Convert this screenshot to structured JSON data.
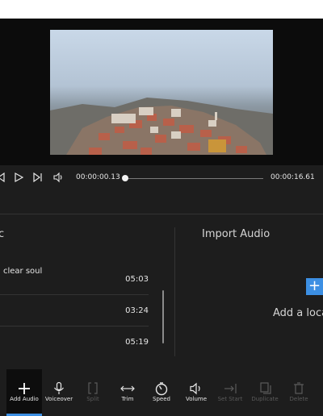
{
  "player": {
    "current_time": "00:00:00.13",
    "total_time": "00:00:16.61",
    "progress": 0.008
  },
  "music_panel": {
    "title": "c",
    "tracks": [
      {
        "name": "clear soul",
        "duration": "05:03"
      },
      {
        "name": "",
        "duration": "03:24"
      },
      {
        "name": "",
        "duration": "05:19"
      }
    ]
  },
  "import_panel": {
    "title": "Import Audio",
    "add_local": "Add a loca",
    "plus": "+"
  },
  "toolbar": [
    {
      "label": "Add Audio",
      "icon": "plus-icon",
      "state": "active"
    },
    {
      "label": "Voiceover",
      "icon": "microphone-icon",
      "state": "enabled"
    },
    {
      "label": "Split",
      "icon": "split-icon",
      "state": "disabled"
    },
    {
      "label": "Trim",
      "icon": "trim-icon",
      "state": "enabled"
    },
    {
      "label": "Speed",
      "icon": "speed-icon",
      "state": "enabled"
    },
    {
      "label": "Volume",
      "icon": "volume-icon",
      "state": "enabled"
    },
    {
      "label": "Set Start",
      "icon": "set-start-icon",
      "state": "disabled"
    },
    {
      "label": "Duplicate",
      "icon": "duplicate-icon",
      "state": "disabled"
    },
    {
      "label": "Delete",
      "icon": "delete-icon",
      "state": "disabled"
    }
  ],
  "colors": {
    "accent": "#3c8fe3",
    "background": "#1d1d1d"
  }
}
